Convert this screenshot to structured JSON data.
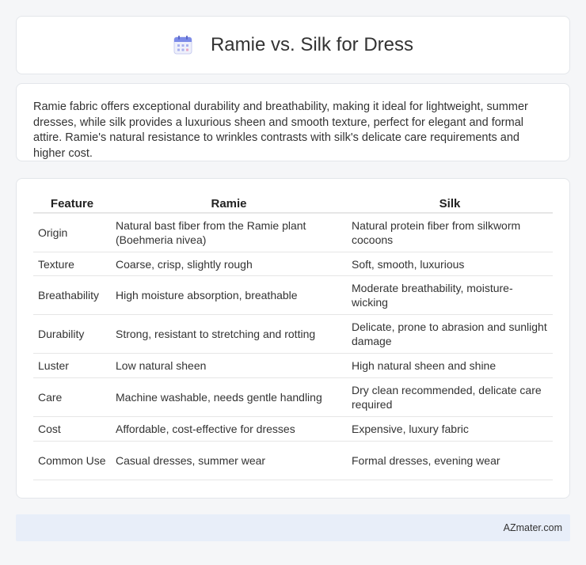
{
  "header": {
    "title": "Ramie vs. Silk for Dress",
    "icon": "calendar-icon"
  },
  "summary": {
    "text": "Ramie fabric offers exceptional durability and breathability, making it ideal for lightweight, summer dresses, while silk provides a luxurious sheen and smooth texture, perfect for elegant and formal attire. Ramie's natural resistance to wrinkles contrasts with silk's delicate care requirements and higher cost."
  },
  "table": {
    "headers": [
      "Feature",
      "Ramie",
      "Silk"
    ],
    "rows": [
      [
        "Origin",
        "Natural bast fiber from the Ramie plant (Boehmeria nivea)",
        "Natural protein fiber from silkworm cocoons"
      ],
      [
        "Texture",
        "Coarse, crisp, slightly rough",
        "Soft, smooth, luxurious"
      ],
      [
        "Breathability",
        "High moisture absorption, breathable",
        "Moderate breathability, moisture-wicking"
      ],
      [
        "Durability",
        "Strong, resistant to stretching and rotting",
        "Delicate, prone to abrasion and sunlight damage"
      ],
      [
        "Luster",
        "Low natural sheen",
        "High natural sheen and shine"
      ],
      [
        "Care",
        "Machine washable, needs gentle handling",
        "Dry clean recommended, delicate care required"
      ],
      [
        "Cost",
        "Affordable, cost-effective for dresses",
        "Expensive, luxury fabric"
      ],
      [
        "Common Use",
        "Casual dresses, summer wear",
        "Formal dresses, evening wear"
      ]
    ]
  },
  "footer": {
    "brand": "AZmater.com"
  }
}
